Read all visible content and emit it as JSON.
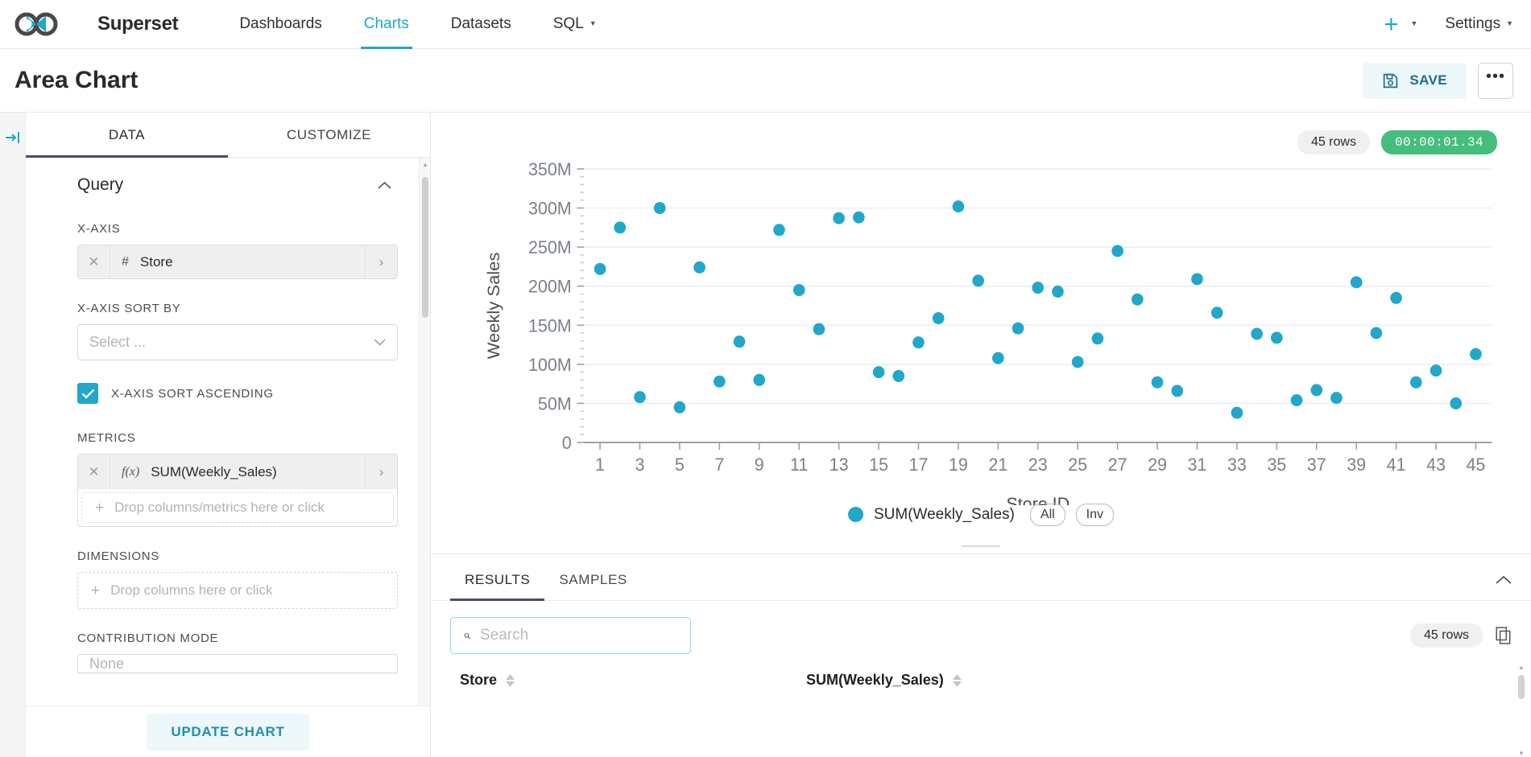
{
  "navbar": {
    "brand": "Superset",
    "links": [
      {
        "label": "Dashboards",
        "active": false,
        "caret": false
      },
      {
        "label": "Charts",
        "active": true,
        "caret": false
      },
      {
        "label": "Datasets",
        "active": false,
        "caret": false
      },
      {
        "label": "SQL",
        "active": false,
        "caret": true
      }
    ],
    "plus_label": "+",
    "settings_label": "Settings"
  },
  "titlebar": {
    "title": "Area Chart",
    "save_label": "SAVE",
    "more_label": "•••"
  },
  "control_panel": {
    "tabs": [
      {
        "label": "DATA",
        "active": true
      },
      {
        "label": "CUSTOMIZE",
        "active": false
      }
    ],
    "section_title": "Query",
    "x_axis": {
      "label": "X-AXIS",
      "value": "Store",
      "type_glyph": "#"
    },
    "x_axis_sort_by": {
      "label": "X-AXIS SORT BY",
      "placeholder": "Select ..."
    },
    "sort_ascending": {
      "label": "X-AXIS SORT ASCENDING",
      "checked": true
    },
    "metrics": {
      "label": "METRICS",
      "value": "SUM(Weekly_Sales)",
      "type_glyph": "f(x)",
      "dropzone": "Drop columns/metrics here or click"
    },
    "dimensions": {
      "label": "DIMENSIONS",
      "dropzone": "Drop columns here or click"
    },
    "contribution_mode": {
      "label": "CONTRIBUTION MODE",
      "value": "None"
    },
    "update_chart_label": "UPDATE CHART"
  },
  "chart_panel": {
    "rows_badge": "45 rows",
    "timer_badge": "00:00:01.34",
    "legend": {
      "series_label": "SUM(Weekly_Sales)",
      "all_label": "All",
      "inv_label": "Inv",
      "color": "#20a7c9"
    }
  },
  "results_panel": {
    "tabs": [
      {
        "label": "RESULTS",
        "active": true
      },
      {
        "label": "SAMPLES",
        "active": false
      }
    ],
    "search_placeholder": "Search",
    "search_value": "",
    "rows_badge": "45 rows",
    "columns": [
      "Store",
      "SUM(Weekly_Sales)"
    ]
  },
  "chart_data": {
    "type": "scatter",
    "title": "",
    "xlabel": "Store ID",
    "ylabel": "Weekly Sales",
    "xlim": [
      0.2,
      45.8
    ],
    "ylim": [
      0,
      350000000
    ],
    "grid": true,
    "legend_position": "bottom",
    "y_tick_labels": [
      "0",
      "50M",
      "100M",
      "150M",
      "200M",
      "250M",
      "300M",
      "350M"
    ],
    "y_tick_values": [
      0,
      50000000,
      100000000,
      150000000,
      200000000,
      250000000,
      300000000,
      350000000
    ],
    "x_tick_values": [
      1,
      3,
      5,
      7,
      9,
      11,
      13,
      15,
      17,
      19,
      21,
      23,
      25,
      27,
      29,
      31,
      33,
      35,
      37,
      39,
      41,
      43,
      45
    ],
    "series": [
      {
        "name": "SUM(Weekly_Sales)",
        "color": "#20a7c9",
        "x": [
          1,
          2,
          3,
          4,
          5,
          6,
          7,
          8,
          9,
          10,
          11,
          12,
          13,
          14,
          15,
          16,
          17,
          18,
          19,
          20,
          21,
          22,
          23,
          24,
          25,
          26,
          27,
          28,
          29,
          30,
          31,
          32,
          33,
          34,
          35,
          36,
          37,
          38,
          39,
          40,
          41,
          42,
          43,
          44,
          45
        ],
        "y": [
          222000000,
          275000000,
          58000000,
          300000000,
          45000000,
          224000000,
          78000000,
          129000000,
          80000000,
          272000000,
          195000000,
          145000000,
          287000000,
          288000000,
          90000000,
          85000000,
          128000000,
          159000000,
          302000000,
          207000000,
          108000000,
          146000000,
          198000000,
          193000000,
          103000000,
          133000000,
          245000000,
          183000000,
          77000000,
          66000000,
          209000000,
          166000000,
          38000000,
          139000000,
          134000000,
          54000000,
          67000000,
          57000000,
          205000000,
          140000000,
          185000000,
          77000000,
          92000000,
          50000000,
          113000000
        ]
      }
    ]
  }
}
